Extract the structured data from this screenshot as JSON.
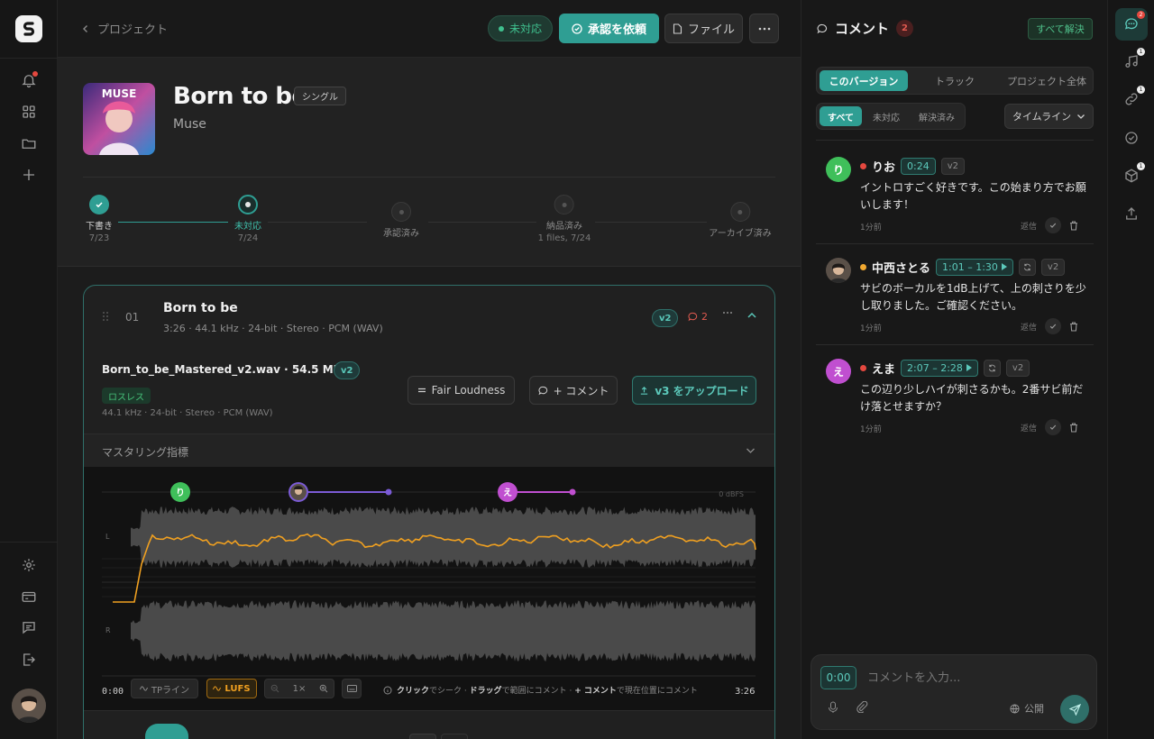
{
  "topbar": {
    "back_label": "プロジェクト",
    "status_label": "未対応",
    "request_label": "承認を依頼",
    "file_label": "ファイル"
  },
  "release": {
    "title": "Born to be",
    "type_tag": "シングル",
    "artist": "Muse",
    "cover_text": "MUSE"
  },
  "workflow": [
    {
      "label": "下書き",
      "sub": "7/23",
      "state": "done"
    },
    {
      "label": "未対応",
      "sub": "7/24",
      "state": "current"
    },
    {
      "label": "承認済み",
      "sub": "",
      "state": "todo"
    },
    {
      "label": "納品済み",
      "sub": "1 files, 7/24",
      "state": "todo"
    },
    {
      "label": "アーカイブ済み",
      "sub": "",
      "state": "todo"
    }
  ],
  "track": {
    "index": "01",
    "name": "Born to be",
    "meta": "3:26 · 44.1 kHz · 24-bit · Stereo · PCM (WAV)",
    "version": "v2",
    "comment_count": "2",
    "file_name": "Born_to_be_Mastered_v2.wav · 54.5 MB",
    "file_version": "v2",
    "lossless_label": "ロスレス",
    "file_meta": "44.1 kHz · 24-bit · Stereo · PCM (WAV)",
    "fair_loudness_label": "Fair Loudness",
    "comment_btn_label": "+ コメント",
    "upload_label": "v3 をアップロード",
    "metrics_label": "マスタリング指標",
    "dbfs_label": "0 dBFS",
    "ch_left": "L",
    "ch_right": "R",
    "time_start": "0:00",
    "time_end": "3:26",
    "tp_label": "TPライン",
    "lufs_label": "LUFS",
    "zoom_label": "1×",
    "hint_click": "クリック",
    "hint_seek": "でシーク · ",
    "hint_drag": "ドラッグ",
    "hint_range": "で範囲にコメント · ",
    "hint_plus": "+ コメント",
    "hint_pos": "で現在位置にコメント"
  },
  "markers": [
    {
      "initial": "り",
      "color": "#3fbf5a"
    },
    {
      "initial": "",
      "color": "#7b5bd6"
    },
    {
      "initial": "え",
      "color": "#c04fd0"
    }
  ],
  "panel": {
    "title": "コメント",
    "count": "2",
    "resolve_all": "すべて解決",
    "scope_tabs": [
      "このバージョン",
      "トラック",
      "プロジェクト全体"
    ],
    "filter_tabs": [
      "すべて",
      "未対応",
      "解決済み"
    ],
    "sort_label": "タイムライン",
    "reply_label": "返信",
    "comments": [
      {
        "initial": "り",
        "avatar_color": "#3fbf5a",
        "dot_color": "#e5483f",
        "name": "りお",
        "time": "0:24",
        "version": "v2",
        "text": "イントロすごく好きです。この始まり方でお願いします！",
        "ago": "1分前"
      },
      {
        "initial": "",
        "avatar_color": "#555",
        "dot_color": "#f0a830",
        "name": "中西さとる",
        "time": "1:01 – 1:30",
        "version": "v2",
        "text": "サビのボーカルを1dB上げて、上の刺さりを少し取りました。ご確認ください。",
        "ago": "1分前"
      },
      {
        "initial": "え",
        "avatar_color": "#c04fd0",
        "dot_color": "#e5483f",
        "name": "えま",
        "time": "2:07 – 2:28",
        "version": "v2",
        "text": "この辺り少しハイが刺さるかも。2番サビ前だけ落とせますか？",
        "ago": "1分前"
      }
    ],
    "composer_time": "0:00",
    "composer_placeholder": "コメントを入力...",
    "visibility_label": "公開"
  },
  "right_rail_badges": [
    "2",
    "1",
    "1",
    "1"
  ],
  "colors": {
    "accent": "#2f9e93",
    "lufs": "#f0a020",
    "status_green": "#3fc08e"
  }
}
